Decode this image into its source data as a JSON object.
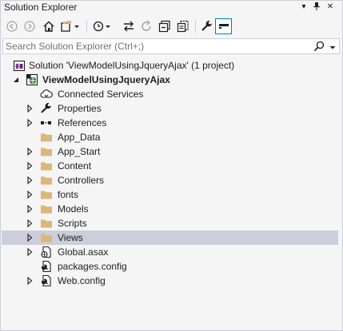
{
  "panel": {
    "title": "Solution Explorer",
    "pin_glyph": "▾",
    "autohide_glyph": "⊥",
    "close_glyph": "✕"
  },
  "search": {
    "placeholder": "Search Solution Explorer (Ctrl+;)"
  },
  "tree": {
    "solution_label": "Solution 'ViewModelUsingJqueryAjax' (1 project)",
    "project_label": "ViewModelUsingJqueryAjax",
    "items": [
      {
        "label": "Connected Services",
        "icon": "cloud-icon"
      },
      {
        "label": "Properties",
        "icon": "wrench-icon"
      },
      {
        "label": "References",
        "icon": "references-icon"
      },
      {
        "label": "App_Data",
        "icon": "folder-icon"
      },
      {
        "label": "App_Start",
        "icon": "folder-icon"
      },
      {
        "label": "Content",
        "icon": "folder-icon"
      },
      {
        "label": "Controllers",
        "icon": "folder-icon"
      },
      {
        "label": "fonts",
        "icon": "folder-icon"
      },
      {
        "label": "Models",
        "icon": "folder-icon"
      },
      {
        "label": "Scripts",
        "icon": "folder-icon"
      },
      {
        "label": "Views",
        "icon": "folder-icon"
      },
      {
        "label": "Global.asax",
        "icon": "asax-file-icon"
      },
      {
        "label": "packages.config",
        "icon": "config-file-icon"
      },
      {
        "label": "Web.config",
        "icon": "config-file-icon"
      }
    ]
  },
  "colors": {
    "background": "#f5f5f5",
    "selection": "#cccedb",
    "folder": "#dcb67a",
    "accent": "#007acc",
    "vs_purple": "#68217a"
  }
}
